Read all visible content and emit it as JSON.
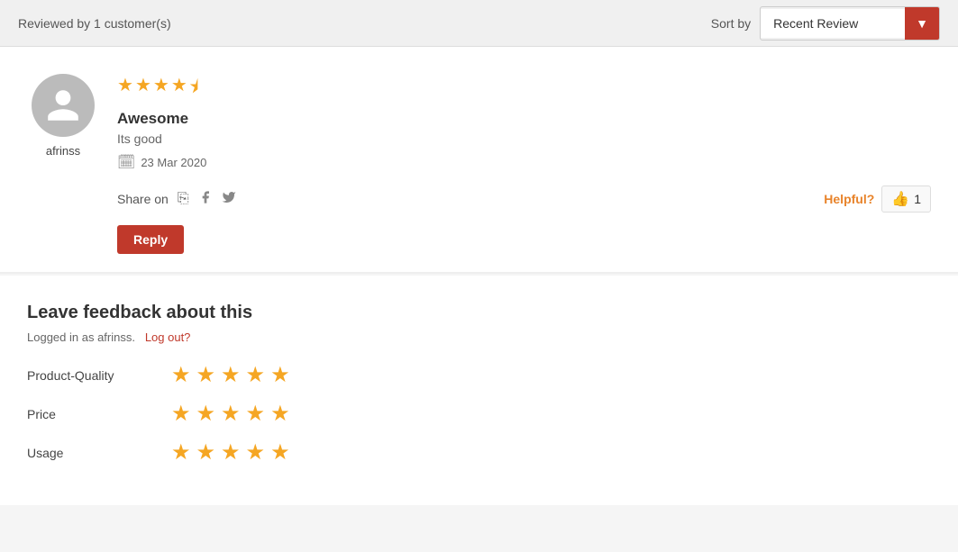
{
  "topBar": {
    "reviewedText": "Reviewed by 1 customer(s)",
    "sortLabel": "Sort by",
    "sortOption": "Recent Review",
    "dropdownArrow": "▼"
  },
  "review": {
    "username": "afrinss",
    "starsDisplay": [
      {
        "type": "full"
      },
      {
        "type": "full"
      },
      {
        "type": "full"
      },
      {
        "type": "full"
      },
      {
        "type": "half"
      }
    ],
    "title": "Awesome",
    "text": "Its good",
    "date": "23 Mar 2020",
    "shareLabel": "Share on",
    "helpfulLabel": "Helpful?",
    "helpfulCount": "1",
    "replyLabel": "Reply"
  },
  "feedback": {
    "title": "Leave feedback about this",
    "loggedInText": "Logged in as afrinss.",
    "logoutText": "Log out?",
    "ratings": [
      {
        "label": "Product-Quality",
        "stars": 5
      },
      {
        "label": "Price",
        "stars": 5
      },
      {
        "label": "Usage",
        "stars": 5
      }
    ]
  }
}
